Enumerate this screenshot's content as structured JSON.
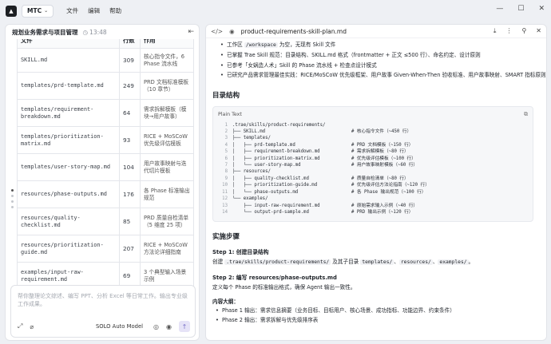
{
  "app": {
    "workspace": "MTC",
    "menu": [
      "文件",
      "编辑",
      "帮助"
    ]
  },
  "left_panel": {
    "title": "规划业务需求与项目管理",
    "time": "13:48",
    "table": {
      "headers": [
        "文件",
        "行数",
        "作用"
      ],
      "rows": [
        {
          "file": "SKILL.md",
          "lines": "309",
          "desc": "核心指令文件，6 Phase 流水线"
        },
        {
          "file": "templates/prd-template.md",
          "lines": "249",
          "desc": "PRD 文档标准模板（10 章节）"
        },
        {
          "file": "templates/requirement-breakdown.md",
          "lines": "64",
          "desc": "需求拆解模板（模块→用户故事）"
        },
        {
          "file": "templates/prioritization-matrix.md",
          "lines": "93",
          "desc": "RICE + MoSCoW 优先级评估模板"
        },
        {
          "file": "templates/user-story-map.md",
          "lines": "104",
          "desc": "用户故事映射与迭代切片模板"
        },
        {
          "file": "resources/phase-outputs.md",
          "lines": "176",
          "desc": "各 Phase 标准输出规范"
        },
        {
          "file": "resources/quality-checklist.md",
          "lines": "85",
          "desc": "PRD 质量自检清单（5 维度 25 项）"
        },
        {
          "file": "resources/prioritization-guide.md",
          "lines": "207",
          "desc": "RICE + MoSCoW 方法论详细指南"
        },
        {
          "file": "examples/input-raw-requirement.md",
          "lines": "69",
          "desc": "3 个典型输入场景示例"
        }
      ]
    },
    "input": {
      "placeholder": "帮你整理论文综述、编写 PPT、分析 Excel 等日常工作。输出专业级工作成果。",
      "model": "SOLO Auto Model"
    }
  },
  "right_panel": {
    "filename": "product-requirements-skill-plan.md",
    "bullets": [
      {
        "pre": "工作区 ",
        "code": "/workspace",
        "post": " 为空，无现有 Skill 文件"
      },
      {
        "pre": "已掌握 Trae Skill 规范：目录结构、SKILL.md 格式（frontmatter + 正文 ≤500 行）、命名约定、设计原则",
        "code": "",
        "post": ""
      },
      {
        "pre": "已参考「女娲造人术」Skill 的 Phase 流水线 + 检查点设计模式",
        "code": "",
        "post": ""
      },
      {
        "pre": "已研究产品需求管理最佳实践：RICE/MoSCoW 优先级框架、用户故事 Given-When-Then 验收标准、用户故事映射、SMART 指标原则",
        "code": "",
        "post": ""
      }
    ],
    "section_title": "目录结构",
    "code_lang": "Plain Text",
    "code_lines": [
      {
        "n": "1",
        "t": ".trae/skills/product-requirements/",
        "c": ""
      },
      {
        "n": "2",
        "t": "├── SKILL.md",
        "c": "# 核心指令文件（~450 行）"
      },
      {
        "n": "3",
        "t": "├── templates/",
        "c": ""
      },
      {
        "n": "4",
        "t": "│   ├── prd-template.md",
        "c": "# PRD 文档模板（~150 行）"
      },
      {
        "n": "5",
        "t": "│   ├── requirement-breakdown.md",
        "c": "# 需求拆解模板（~80 行）"
      },
      {
        "n": "6",
        "t": "│   ├── prioritization-matrix.md",
        "c": "# 优先级评估模板（~100 行）"
      },
      {
        "n": "7",
        "t": "│   └── user-story-map.md",
        "c": "# 用户故事映射模板（~60 行）"
      },
      {
        "n": "8",
        "t": "├── resources/",
        "c": ""
      },
      {
        "n": "9",
        "t": "│   ├── quality-checklist.md",
        "c": "# 质量自检清单（~80 行）"
      },
      {
        "n": "10",
        "t": "│   ├── prioritization-guide.md",
        "c": "# 优先级评估方法论指南（~120 行）"
      },
      {
        "n": "11",
        "t": "│   └── phase-outputs.md",
        "c": "# 各 Phase 输出规范（~100 行）"
      },
      {
        "n": "12",
        "t": "└── examples/",
        "c": ""
      },
      {
        "n": "13",
        "t": "    ├── input-raw-requirement.md",
        "c": "# 原始需求输入示例（~40 行）"
      },
      {
        "n": "14",
        "t": "    └── output-prd-sample.md",
        "c": "# PRD 输出示例（~120 行）"
      }
    ],
    "steps_title": "实施步骤",
    "step1": {
      "title": "Step 1: 创建目录结构",
      "pre": "创建 ",
      "code1": ".trae/skills/product-requirements/",
      "mid": " 及其子目录 ",
      "code2": "templates/",
      "sep1": "、",
      "code3": "resources/",
      "sep2": "、",
      "code4": "examples/",
      "end": "。"
    },
    "step2": {
      "title": "Step 2: 编写 resources/phase-outputs.md",
      "desc": "定义每个 Phase 的标准输出格式，确保 Agent 输出一致性。",
      "sub": "内容大纲：",
      "items": [
        "Phase 1 输出：需求信息摘要（业务目标、目标用户、核心场景、成功指标、功能边界、约束条件）",
        "Phase 2 输出：需求拆解与优先级排序表"
      ]
    }
  }
}
